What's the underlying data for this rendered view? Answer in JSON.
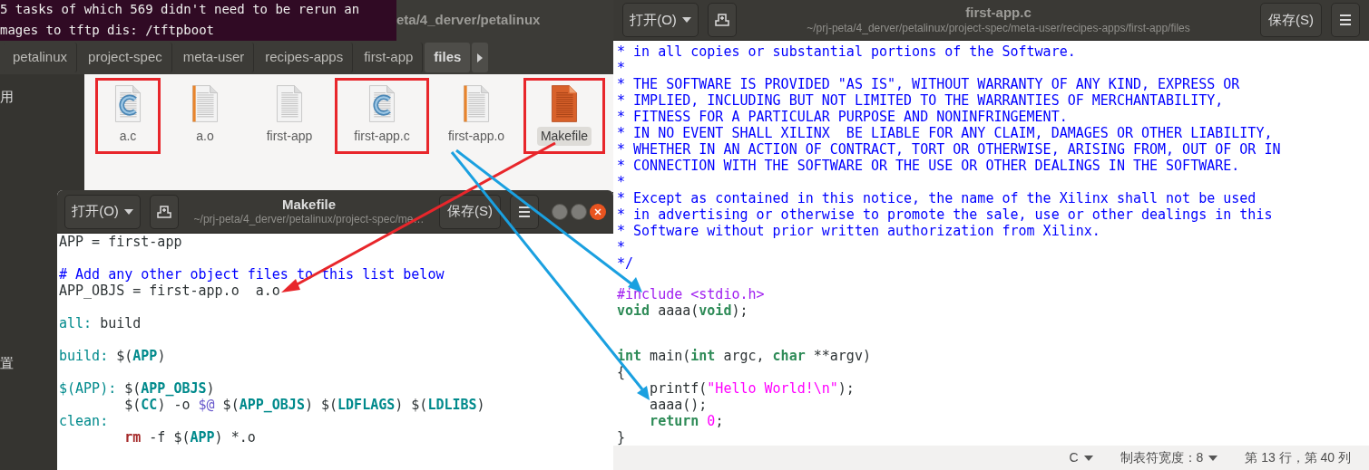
{
  "terminal": {
    "lines": [
      "5 tasks of which 569 didn't need to be rerun an",
      "mages to tftp dis: /tftpboot"
    ]
  },
  "file_manager": {
    "title": "eta/4_derver/petalinux",
    "path": [
      {
        "label": "petalinux",
        "selected": false
      },
      {
        "label": "project-spec",
        "selected": false
      },
      {
        "label": "meta-user",
        "selected": false
      },
      {
        "label": "recipes-apps",
        "selected": false
      },
      {
        "label": "first-app",
        "selected": false
      },
      {
        "label": "files",
        "selected": true
      }
    ],
    "sidebar": [
      "用",
      "置"
    ],
    "files": [
      {
        "name": "a.c",
        "kind": "c-source",
        "highlighted": true,
        "selected": false
      },
      {
        "name": "a.o",
        "kind": "object",
        "highlighted": false,
        "selected": false
      },
      {
        "name": "first-app",
        "kind": "text",
        "highlighted": false,
        "selected": false
      },
      {
        "name": "first-app.c",
        "kind": "c-source",
        "highlighted": true,
        "selected": false
      },
      {
        "name": "first-app.o",
        "kind": "object",
        "highlighted": false,
        "selected": false
      },
      {
        "name": "Makefile",
        "kind": "makefile",
        "highlighted": true,
        "selected": true
      }
    ]
  },
  "makefile_editor": {
    "open_button": "打开(O)",
    "title": "Makefile",
    "subtitle": "~/prj-peta/4_derver/petalinux/project-spec/me…",
    "save_button": "保存(S)",
    "lines": [
      {
        "kind": "code",
        "segments": [
          {
            "text": "APP = first-app",
            "kind": "plain"
          }
        ]
      },
      {
        "kind": "blank"
      },
      {
        "kind": "code",
        "segments": [
          {
            "text": "# Add any other object files to this list below",
            "kind": "comment"
          }
        ]
      },
      {
        "kind": "code",
        "segments": [
          {
            "text": "APP_OBJS = first-app.o  a.o",
            "kind": "plain"
          }
        ]
      },
      {
        "kind": "blank"
      },
      {
        "kind": "code",
        "segments": [
          {
            "text": "all:",
            "kind": "target"
          },
          {
            "text": " build",
            "kind": "plain"
          }
        ]
      },
      {
        "kind": "blank"
      },
      {
        "kind": "code",
        "segments": [
          {
            "text": "build:",
            "kind": "target"
          },
          {
            "text": " $(",
            "kind": "plain"
          },
          {
            "text": "APP",
            "kind": "variable"
          },
          {
            "text": ")",
            "kind": "plain"
          }
        ]
      },
      {
        "kind": "blank"
      },
      {
        "kind": "code",
        "segments": [
          {
            "text": "$(APP):",
            "kind": "target"
          },
          {
            "text": " $(",
            "kind": "plain"
          },
          {
            "text": "APP_OBJS",
            "kind": "variable"
          },
          {
            "text": ")",
            "kind": "plain"
          }
        ]
      },
      {
        "kind": "code",
        "segments": [
          {
            "text": "\t$(",
            "kind": "plain"
          },
          {
            "text": "CC",
            "kind": "variable"
          },
          {
            "text": ") -o ",
            "kind": "plain"
          },
          {
            "text": "$@",
            "kind": "special"
          },
          {
            "text": " $(",
            "kind": "plain"
          },
          {
            "text": "APP_OBJS",
            "kind": "variable"
          },
          {
            "text": ") $(",
            "kind": "plain"
          },
          {
            "text": "LDFLAGS",
            "kind": "variable"
          },
          {
            "text": ") $(",
            "kind": "plain"
          },
          {
            "text": "LDLIBS",
            "kind": "variable"
          },
          {
            "text": ")",
            "kind": "plain"
          }
        ]
      },
      {
        "kind": "code",
        "segments": [
          {
            "text": "clean:",
            "kind": "target"
          }
        ]
      },
      {
        "kind": "code",
        "segments": [
          {
            "text": "\trm",
            "kind": "command"
          },
          {
            "text": " -f $(",
            "kind": "plain"
          },
          {
            "text": "APP",
            "kind": "variable"
          },
          {
            "text": ") *.o",
            "kind": "plain"
          }
        ]
      }
    ]
  },
  "source_editor": {
    "open_button": "打开(O)",
    "title": "first-app.c",
    "subtitle": "~/prj-peta/4_derver/petalinux/project-spec/meta-user/recipes-apps/first-app/files",
    "save_button": "保存(S)",
    "lines": [
      {
        "kind": "code",
        "segments": [
          {
            "text": "* in all copies or substantial portions of the Software.",
            "kind": "comment"
          }
        ]
      },
      {
        "kind": "code",
        "segments": [
          {
            "text": "*",
            "kind": "comment"
          }
        ]
      },
      {
        "kind": "code",
        "segments": [
          {
            "text": "* THE SOFTWARE IS PROVIDED \"AS IS\", WITHOUT WARRANTY OF ANY KIND, EXPRESS OR",
            "kind": "comment"
          }
        ]
      },
      {
        "kind": "code",
        "segments": [
          {
            "text": "* IMPLIED, INCLUDING BUT NOT LIMITED TO THE WARRANTIES OF MERCHANTABILITY,",
            "kind": "comment"
          }
        ]
      },
      {
        "kind": "code",
        "segments": [
          {
            "text": "* FITNESS FOR A PARTICULAR PURPOSE AND NONINFRINGEMENT.",
            "kind": "comment"
          }
        ]
      },
      {
        "kind": "code",
        "segments": [
          {
            "text": "* IN NO EVENT SHALL XILINX  BE LIABLE FOR ANY CLAIM, DAMAGES OR OTHER LIABILITY,",
            "kind": "comment"
          }
        ]
      },
      {
        "kind": "code",
        "segments": [
          {
            "text": "* WHETHER IN AN ACTION OF CONTRACT, TORT OR OTHERWISE, ARISING FROM, OUT OF OR IN",
            "kind": "comment"
          }
        ]
      },
      {
        "kind": "code",
        "segments": [
          {
            "text": "* CONNECTION WITH THE SOFTWARE OR THE USE OR OTHER DEALINGS IN THE SOFTWARE.",
            "kind": "comment"
          }
        ]
      },
      {
        "kind": "code",
        "segments": [
          {
            "text": "*",
            "kind": "comment"
          }
        ]
      },
      {
        "kind": "code",
        "segments": [
          {
            "text": "* Except as contained in this notice, the name of the Xilinx shall not be used",
            "kind": "comment"
          }
        ]
      },
      {
        "kind": "code",
        "segments": [
          {
            "text": "* in advertising or otherwise to promote the sale, use or other dealings in this",
            "kind": "comment"
          }
        ]
      },
      {
        "kind": "code",
        "segments": [
          {
            "text": "* Software without prior written authorization from Xilinx.",
            "kind": "comment"
          }
        ]
      },
      {
        "kind": "code",
        "segments": [
          {
            "text": "*",
            "kind": "comment"
          }
        ]
      },
      {
        "kind": "code",
        "segments": [
          {
            "text": "*/",
            "kind": "comment"
          }
        ]
      },
      {
        "kind": "blank"
      },
      {
        "kind": "code",
        "segments": [
          {
            "text": "#include <stdio.h>",
            "kind": "preproc"
          }
        ]
      },
      {
        "kind": "code",
        "segments": [
          {
            "text": "void",
            "kind": "type"
          },
          {
            "text": " aaaa(",
            "kind": "plain"
          },
          {
            "text": "void",
            "kind": "type"
          },
          {
            "text": ");",
            "kind": "plain"
          }
        ]
      },
      {
        "kind": "blank"
      },
      {
        "kind": "blank"
      },
      {
        "kind": "code",
        "segments": [
          {
            "text": "int",
            "kind": "type"
          },
          {
            "text": " main(",
            "kind": "plain"
          },
          {
            "text": "int",
            "kind": "type"
          },
          {
            "text": " argc, ",
            "kind": "plain"
          },
          {
            "text": "char",
            "kind": "type"
          },
          {
            "text": " **argv)",
            "kind": "plain"
          }
        ]
      },
      {
        "kind": "code",
        "segments": [
          {
            "text": "{",
            "kind": "plain"
          }
        ]
      },
      {
        "kind": "code",
        "segments": [
          {
            "text": "    printf(",
            "kind": "plain"
          },
          {
            "text": "\"Hello World!\\n\"",
            "kind": "string"
          },
          {
            "text": ");",
            "kind": "plain"
          }
        ]
      },
      {
        "kind": "code",
        "segments": [
          {
            "text": "    aaaa();",
            "kind": "plain"
          }
        ]
      },
      {
        "kind": "code",
        "segments": [
          {
            "text": "    return",
            "kind": "type"
          },
          {
            "text": " 0",
            "kind": "string"
          },
          {
            "text": ";",
            "kind": "plain"
          }
        ]
      },
      {
        "kind": "code",
        "segments": [
          {
            "text": "}",
            "kind": "plain"
          }
        ]
      }
    ],
    "status_bar": {
      "language": "C",
      "tab_width": "制表符宽度：8",
      "position": "第 13 行，第 40 列"
    }
  }
}
